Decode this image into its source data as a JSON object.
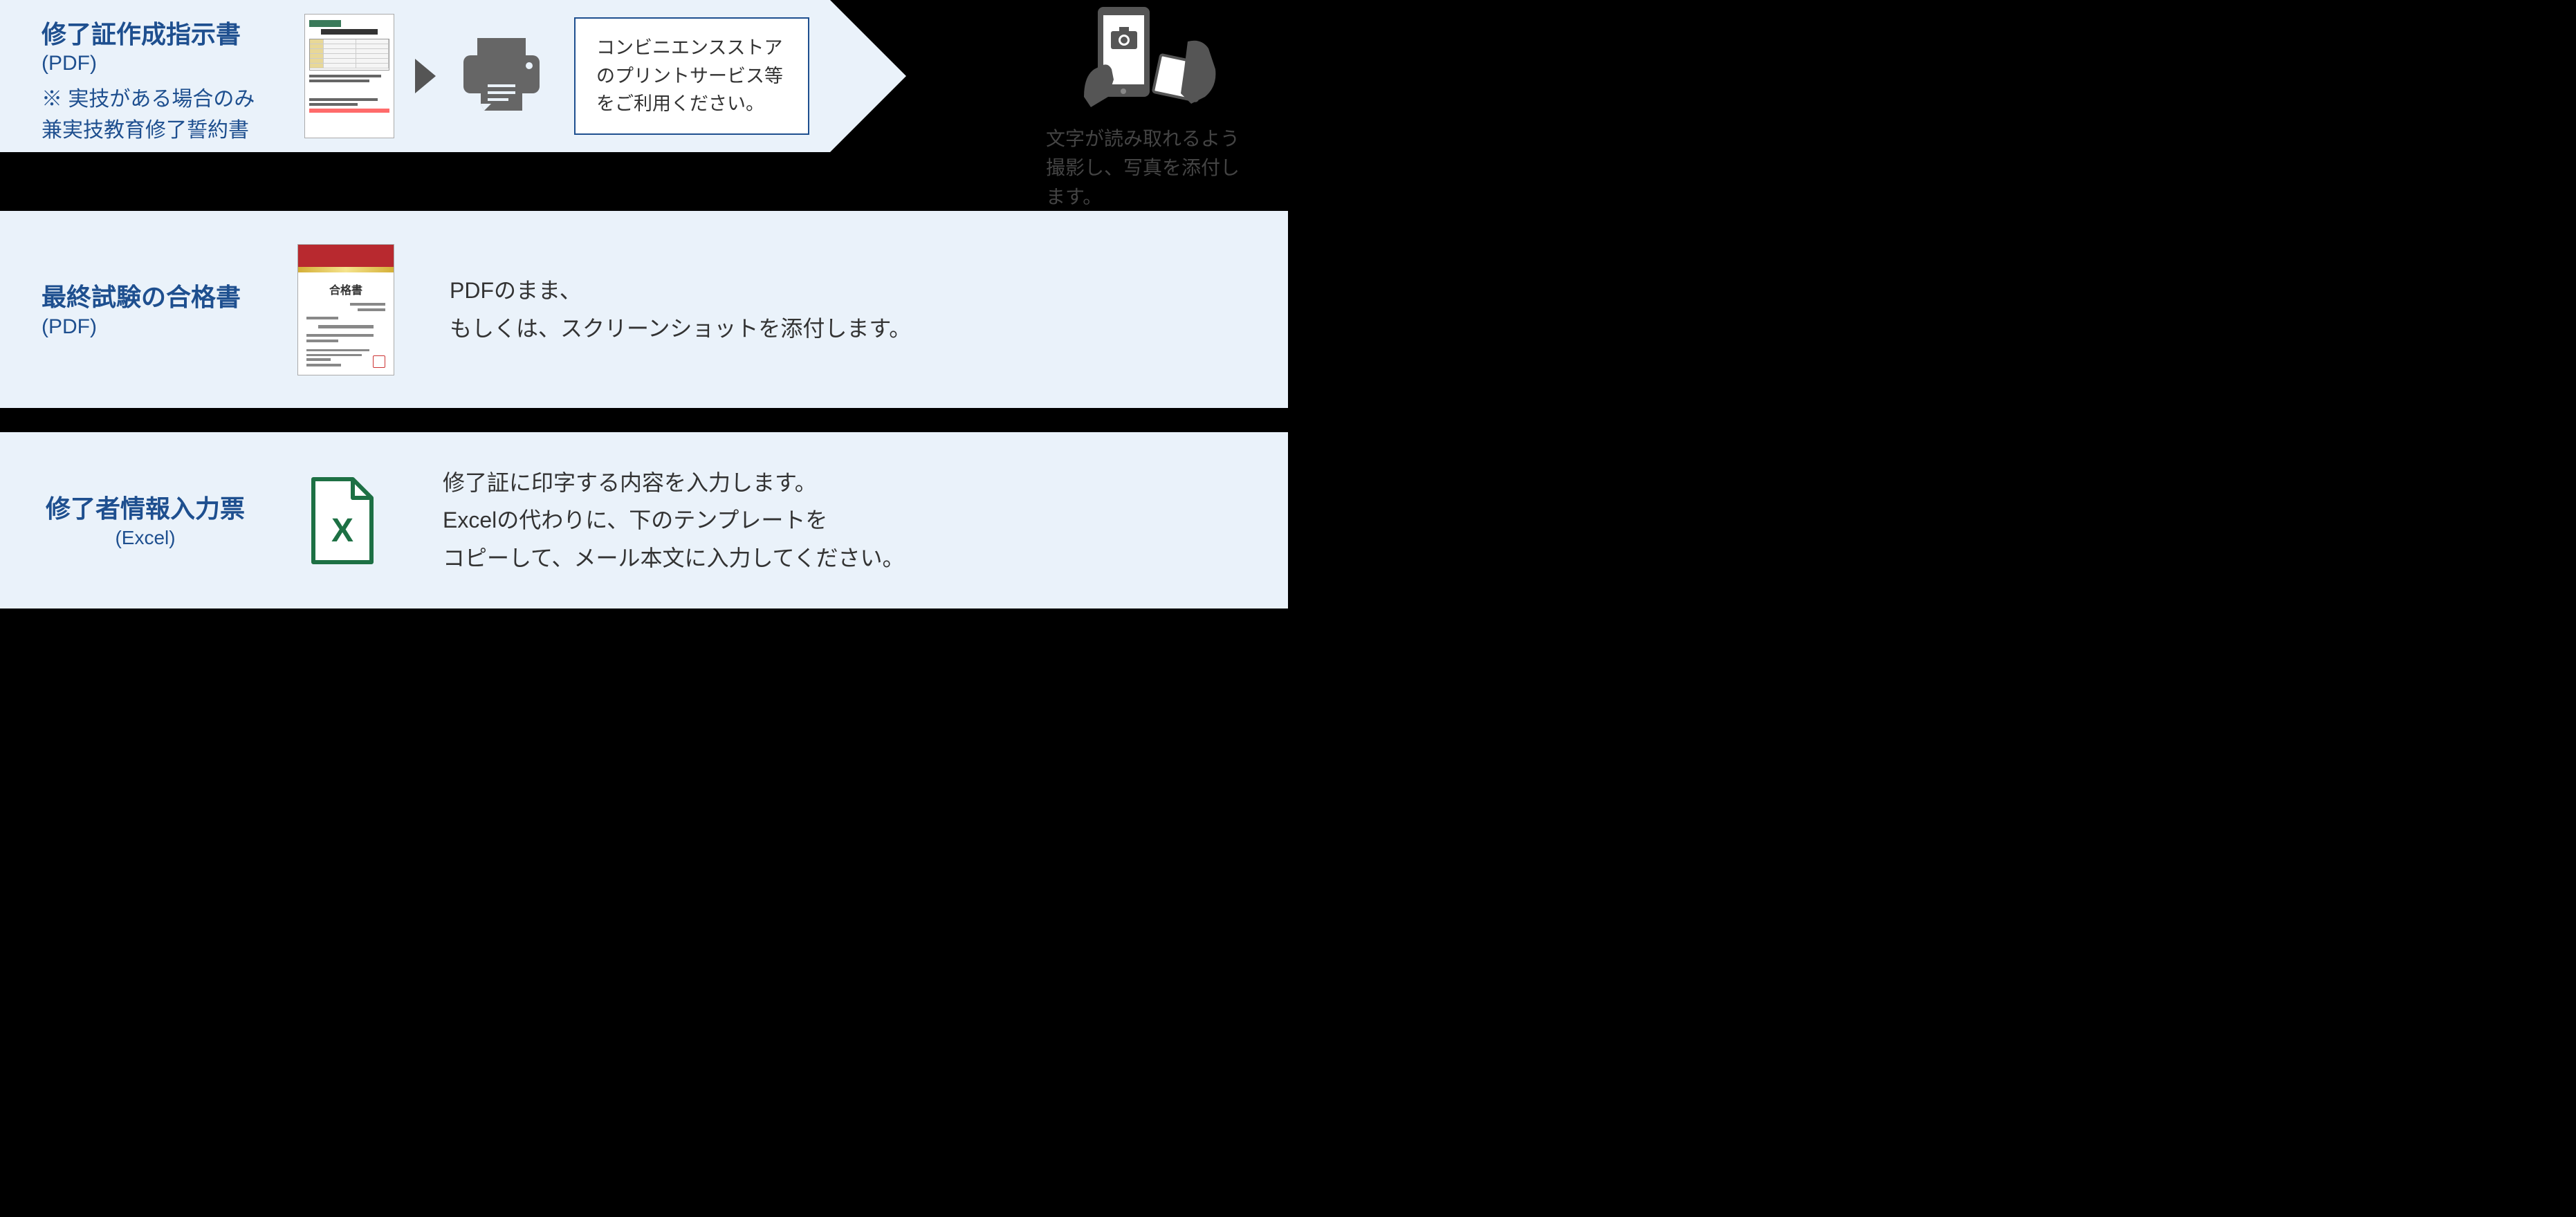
{
  "row1": {
    "title": "修了証作成指示書",
    "format": "(PDF)",
    "subtitle": "※ 実技がある場合のみ\n兼実技教育修了誓約書",
    "infobox": "コンビニエンスストアのプリントサービス等をご利用ください。",
    "camera_text": "文字が読み取れるよう撮影し、写真を添付します。"
  },
  "row2": {
    "title": "最終試験の合格書",
    "format": "(PDF)",
    "cert_title": "合格書",
    "desc": "PDFのまま、\nもしくは、スクリーンショットを添付します。"
  },
  "row3": {
    "title": "修了者情報入力票",
    "format": "(Excel)",
    "desc": "修了証に印字する内容を入力します。\nExcelの代わりに、下のテンプレートを\nコピーして、メール本文に入力してください。"
  }
}
